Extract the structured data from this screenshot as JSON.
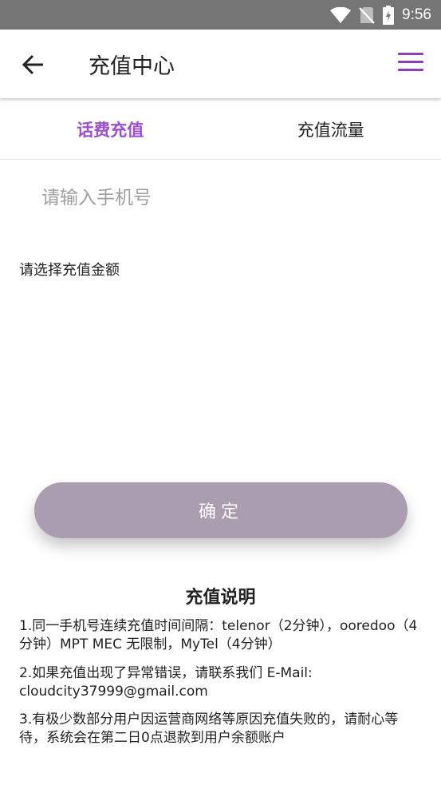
{
  "status_bar": {
    "time": "9:56",
    "icons": [
      "wifi-icon",
      "no-sim-icon",
      "battery-charging-icon"
    ]
  },
  "header": {
    "title": "充值中心",
    "back_icon": "back-arrow-icon",
    "menu_icon": "menu-icon",
    "accent_color": "#9c4fd0"
  },
  "tabs": [
    {
      "label": "话费充值",
      "active": true
    },
    {
      "label": "充值流量",
      "active": false
    }
  ],
  "phone_input": {
    "placeholder": "请输入手机号",
    "value": ""
  },
  "amount_section": {
    "label": "请选择充值金额"
  },
  "confirm_button": {
    "label": "确定",
    "color": "#a99daf"
  },
  "notes": {
    "title": "充值说明",
    "items": [
      "1.同一手机号连续充值时间间隔：telenor（2分钟），ooredoo（4分钟）MPT MEC 无限制，MyTel（4分钟）",
      "2.如果充值出现了异常错误，请联系我们 E-Mail: cloudcity37999@gmail.com",
      "3.有极少数部分用户因运营商网络等原因充值失败的，请耐心等待，系统会在第二日0点退款到用户余额账户"
    ]
  }
}
